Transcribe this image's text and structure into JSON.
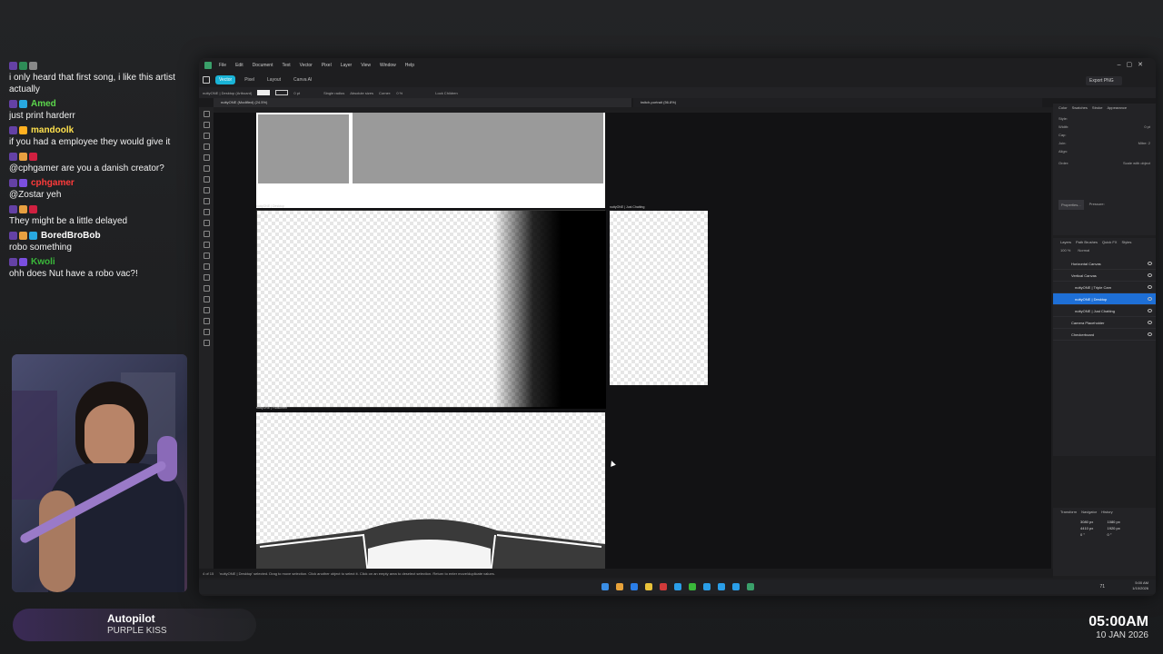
{
  "chat": {
    "messages": [
      {
        "user": "",
        "text": "i only heard that first song, i like this artist actually",
        "color": "#ffffff",
        "badges": [
          "#6441a5",
          "#2e8b57",
          "#888888"
        ]
      },
      {
        "user": "Amed",
        "text": "just print harderr",
        "color": "#5cd64c",
        "badges": [
          "#6441a5",
          "#28a8e0"
        ]
      },
      {
        "user": "mandoolk",
        "text": "if you had a employee they would give it",
        "color": "#ffe14d",
        "badges": [
          "#6441a5",
          "#ffb020"
        ]
      },
      {
        "user": "",
        "text": "@cphgamer are you a danish creator?",
        "color": "#ff3b3b",
        "badges": [
          "#6441a5",
          "#e8a040",
          "#d02040"
        ]
      },
      {
        "user": "cphgamer",
        "text": "@Zostar yeh",
        "color": "#ff3b3b",
        "badges": [
          "#6441a5",
          "#7b4fe0"
        ]
      },
      {
        "user": "",
        "text": "They might be a little delayed",
        "color": "#ff3b3b",
        "badges": [
          "#6441a5",
          "#e8a040",
          "#d02040"
        ]
      },
      {
        "user": "BoredBroBob",
        "text": "robo something",
        "color": "#ffffff",
        "badges": [
          "#6441a5",
          "#e8a040",
          "#28a8e0"
        ]
      },
      {
        "user": "Kwoli",
        "text": "ohh does Nut have a robo vac?!",
        "color": "#3ab83a",
        "badges": [
          "#6441a5",
          "#7b4fe0"
        ]
      }
    ]
  },
  "now_playing": {
    "title": "Autopilot",
    "artist": "PURPLE KISS"
  },
  "clock": {
    "time": "05:00AM",
    "date": "10 JAN 2026"
  },
  "app": {
    "menu": [
      "File",
      "Edit",
      "Document",
      "Text",
      "Vector",
      "Pixel",
      "Layer",
      "View",
      "Window",
      "Help"
    ],
    "modes": [
      "Vector",
      "Pixel",
      "Layout",
      "Canva AI"
    ],
    "context": {
      "selection": "nuttyONE | Desktop (Artboard)",
      "stroke": "0 pt",
      "single_radius": "Single radius",
      "absolute_sizes": "Absolute sizes",
      "corner": "Corner:",
      "corner_val": "0 %",
      "lock_children": "Lock Children"
    },
    "tabs": [
      "nuttyONE (Modified) (24.5%)",
      "twitch-portrait (56.8%)"
    ],
    "export": "Export PNG",
    "artboards": {
      "desktop": "nuttyONE | Desktop",
      "just_chatting": "nuttyONE | Just Chatting",
      "third": "nuttyONE | Fullscreen"
    },
    "right_tabs": [
      "Color",
      "Swatches",
      "Stroke",
      "Appearance"
    ],
    "stroke_panel": {
      "style": "Style:",
      "width": "Width:",
      "width_val": "0 pt",
      "cap": "Cap:",
      "join": "Join:",
      "mitre": "Mitre:",
      "mitre_val": "2",
      "align": "Align:",
      "order": "Order:",
      "scale": "Scale with object",
      "props": "Properties...",
      "pressure": "Pressure:"
    },
    "layer_tabs": [
      "Layers",
      "Path Brushes",
      "Quick FX",
      "Styles"
    ],
    "opacity": "100 %",
    "blend": "Normal",
    "layers": [
      {
        "name": "Horizontal Canvas",
        "indent": 0,
        "selected": false
      },
      {
        "name": "Vertical Canvas",
        "indent": 0,
        "selected": false
      },
      {
        "name": "nuttyONE | Triple Cam",
        "indent": 1,
        "selected": false
      },
      {
        "name": "nuttyONE | Desktop",
        "indent": 1,
        "selected": true
      },
      {
        "name": "nuttyONE | Just Chatting",
        "indent": 1,
        "selected": false
      },
      {
        "name": "Camera Placeholder",
        "indent": 0,
        "selected": false
      },
      {
        "name": "Checkerboard",
        "indent": 0,
        "selected": false
      }
    ],
    "transform_tabs": [
      "Transform",
      "Navigator",
      "History"
    ],
    "transform": {
      "w": "3080 px",
      "h": "4410 px",
      "w2": "1080 px",
      "h2": "1920 px",
      "r": "0 °",
      "s": "0 °"
    },
    "pager": "4 of 15",
    "status": "'nuttyONE | Desktop' selected. Drag to move selection. Click another object to select it. Click on an empty area to deselect selection. Return to enter move/duplicate values.",
    "tray": {
      "time": "5:00 AM",
      "date": "1/10/2026",
      "temp": "71"
    }
  }
}
